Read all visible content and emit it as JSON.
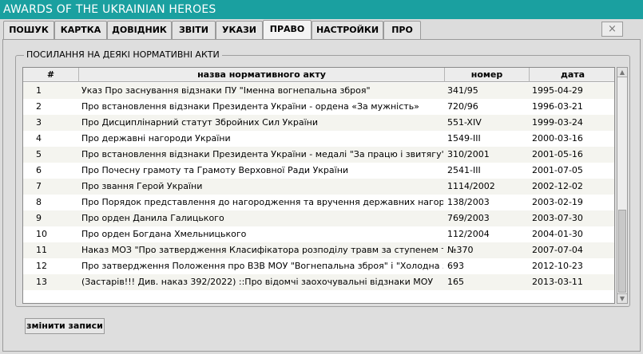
{
  "window": {
    "title": "AWARDS OF THE UKRAINIAN HEROES",
    "close_label": "×"
  },
  "tabs": [
    {
      "label": "ПОШУК"
    },
    {
      "label": "КАРТКА"
    },
    {
      "label": "ДОВІДНИК"
    },
    {
      "label": "ЗВІТИ"
    },
    {
      "label": "УКАЗИ"
    },
    {
      "label": "ПРАВО",
      "active": true
    },
    {
      "label": "НАСТРОЙКИ"
    },
    {
      "label": "ПРО"
    }
  ],
  "group": {
    "title": "ПОСИЛАННЯ НА ДЕЯКІ НОРМАТИВНІ АКТИ"
  },
  "table": {
    "columns": [
      "#",
      "назва нормативного акту",
      "номер",
      "дата"
    ],
    "rows": [
      [
        "1",
        "Указ Про заснування відзнаки ПУ \"Іменна вогнепальна зброя\"",
        "341/95",
        "1995-04-29"
      ],
      [
        "2",
        "Про встановлення відзнаки Президента України - ордена «За мужність»",
        "720/96",
        "1996-03-21"
      ],
      [
        "3",
        "Про Дисциплінарний статут Збройних Сил України",
        "551-XIV",
        "1999-03-24"
      ],
      [
        "4",
        "Про державні нагороди України",
        "1549-III",
        "2000-03-16"
      ],
      [
        "5",
        "Про встановлення відзнаки Президента України - медалі \"За працю і звитягу\"",
        "310/2001",
        "2001-05-16"
      ],
      [
        "6",
        "Про Почесну грамоту та Грамоту Верховної Ради України",
        "2541-III",
        "2001-07-05"
      ],
      [
        "7",
        "Про звання Герой України",
        "1114/2002",
        "2002-12-02"
      ],
      [
        "8",
        "Про Порядок представлення до нагородження та вручення державних нагород",
        "138/2003",
        "2003-02-19"
      ],
      [
        "9",
        "Про орден Данила Галицького",
        "769/2003",
        "2003-07-30"
      ],
      [
        "10",
        "Про орден Богдана Хмельницького",
        "112/2004",
        "2004-01-30"
      ],
      [
        "11",
        "Наказ МОЗ \"Про затвердження Класифікатора розподілу травм за ступенем тяжкос",
        "№370",
        "2007-07-04"
      ],
      [
        "12",
        "Про затвердження Положення про ВЗВ МОУ \"Вогнепальна зброя\" і \"Холодна зброя",
        "693",
        "2012-10-23"
      ],
      [
        "13",
        "(Застарів!!! Див. наказ 392/2022) ::Про відомчі заохочувальні відзнаки МОУ",
        "165",
        "2013-03-11"
      ],
      [
        "",
        "",
        "",
        ""
      ]
    ]
  },
  "buttons": {
    "edit_label": "змінити записи"
  },
  "scrollbar": {
    "up_icon": "▲",
    "down_icon": "▼"
  }
}
